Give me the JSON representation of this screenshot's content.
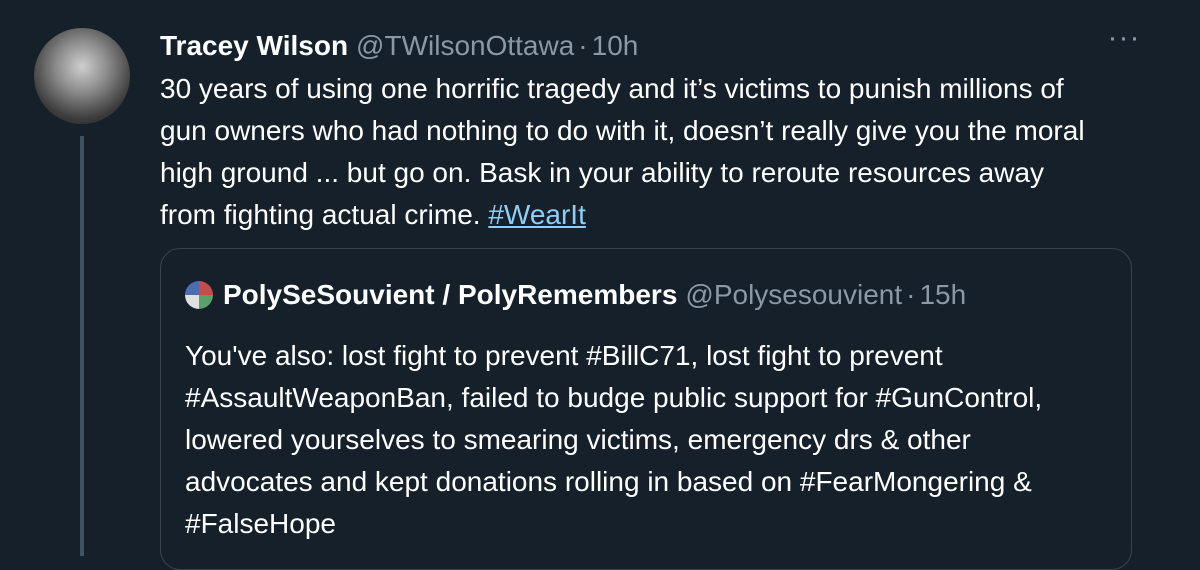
{
  "tweet": {
    "author_name": "Tracey Wilson",
    "author_handle": "@TWilsonOttawa",
    "separator": "·",
    "time": "10h",
    "more_icon": "more-horizontal-icon",
    "body_lines": [
      "30 years of using one horrific tragedy and it’s victims to punish millions of",
      "gun owners who had nothing to do with it, doesn’t really give you the moral",
      "high ground ... but go on. Bask in your ability to reroute resources away"
    ],
    "body_last_line": "from fighting actual crime. ",
    "hashtag": "#WearIt"
  },
  "quote": {
    "author_name": "PolySeSouvient / PolyRemembers",
    "author_handle": "@Polysesouvient",
    "separator": "·",
    "time": "15h",
    "lines": [
      "You've also: lost fight to prevent #BillC71, lost fight to prevent",
      "#AssaultWeaponBan, failed to budge public support for #GunControl,",
      "lowered yourselves to smearing victims, emergency drs & other",
      "advocates and kept donations rolling in based on #FearMongering &",
      "#FalseHope"
    ]
  },
  "colors": {
    "background": "#15202b",
    "text": "#ffffff",
    "secondary": "#8b98a5",
    "link": "#8ecdf8",
    "border": "#38444d"
  }
}
